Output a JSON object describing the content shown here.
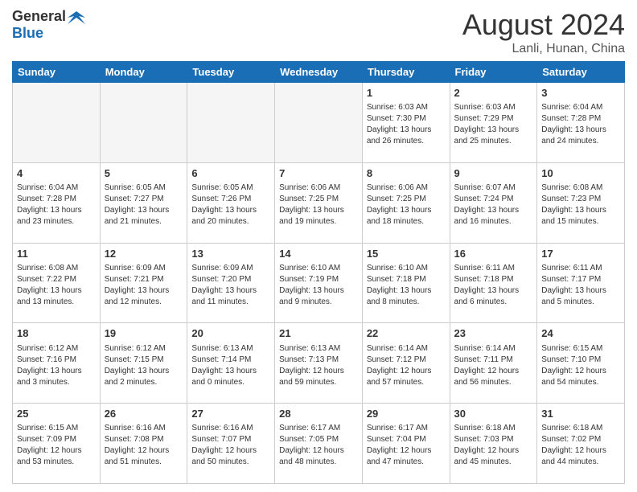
{
  "logo": {
    "general": "General",
    "blue": "Blue"
  },
  "title": "August 2024",
  "location": "Lanli, Hunan, China",
  "days_header": [
    "Sunday",
    "Monday",
    "Tuesday",
    "Wednesday",
    "Thursday",
    "Friday",
    "Saturday"
  ],
  "weeks": [
    [
      {
        "day": "",
        "info": ""
      },
      {
        "day": "",
        "info": ""
      },
      {
        "day": "",
        "info": ""
      },
      {
        "day": "",
        "info": ""
      },
      {
        "day": "1",
        "info": "Sunrise: 6:03 AM\nSunset: 7:30 PM\nDaylight: 13 hours\nand 26 minutes."
      },
      {
        "day": "2",
        "info": "Sunrise: 6:03 AM\nSunset: 7:29 PM\nDaylight: 13 hours\nand 25 minutes."
      },
      {
        "day": "3",
        "info": "Sunrise: 6:04 AM\nSunset: 7:28 PM\nDaylight: 13 hours\nand 24 minutes."
      }
    ],
    [
      {
        "day": "4",
        "info": "Sunrise: 6:04 AM\nSunset: 7:28 PM\nDaylight: 13 hours\nand 23 minutes."
      },
      {
        "day": "5",
        "info": "Sunrise: 6:05 AM\nSunset: 7:27 PM\nDaylight: 13 hours\nand 21 minutes."
      },
      {
        "day": "6",
        "info": "Sunrise: 6:05 AM\nSunset: 7:26 PM\nDaylight: 13 hours\nand 20 minutes."
      },
      {
        "day": "7",
        "info": "Sunrise: 6:06 AM\nSunset: 7:25 PM\nDaylight: 13 hours\nand 19 minutes."
      },
      {
        "day": "8",
        "info": "Sunrise: 6:06 AM\nSunset: 7:25 PM\nDaylight: 13 hours\nand 18 minutes."
      },
      {
        "day": "9",
        "info": "Sunrise: 6:07 AM\nSunset: 7:24 PM\nDaylight: 13 hours\nand 16 minutes."
      },
      {
        "day": "10",
        "info": "Sunrise: 6:08 AM\nSunset: 7:23 PM\nDaylight: 13 hours\nand 15 minutes."
      }
    ],
    [
      {
        "day": "11",
        "info": "Sunrise: 6:08 AM\nSunset: 7:22 PM\nDaylight: 13 hours\nand 13 minutes."
      },
      {
        "day": "12",
        "info": "Sunrise: 6:09 AM\nSunset: 7:21 PM\nDaylight: 13 hours\nand 12 minutes."
      },
      {
        "day": "13",
        "info": "Sunrise: 6:09 AM\nSunset: 7:20 PM\nDaylight: 13 hours\nand 11 minutes."
      },
      {
        "day": "14",
        "info": "Sunrise: 6:10 AM\nSunset: 7:19 PM\nDaylight: 13 hours\nand 9 minutes."
      },
      {
        "day": "15",
        "info": "Sunrise: 6:10 AM\nSunset: 7:18 PM\nDaylight: 13 hours\nand 8 minutes."
      },
      {
        "day": "16",
        "info": "Sunrise: 6:11 AM\nSunset: 7:18 PM\nDaylight: 13 hours\nand 6 minutes."
      },
      {
        "day": "17",
        "info": "Sunrise: 6:11 AM\nSunset: 7:17 PM\nDaylight: 13 hours\nand 5 minutes."
      }
    ],
    [
      {
        "day": "18",
        "info": "Sunrise: 6:12 AM\nSunset: 7:16 PM\nDaylight: 13 hours\nand 3 minutes."
      },
      {
        "day": "19",
        "info": "Sunrise: 6:12 AM\nSunset: 7:15 PM\nDaylight: 13 hours\nand 2 minutes."
      },
      {
        "day": "20",
        "info": "Sunrise: 6:13 AM\nSunset: 7:14 PM\nDaylight: 13 hours\nand 0 minutes."
      },
      {
        "day": "21",
        "info": "Sunrise: 6:13 AM\nSunset: 7:13 PM\nDaylight: 12 hours\nand 59 minutes."
      },
      {
        "day": "22",
        "info": "Sunrise: 6:14 AM\nSunset: 7:12 PM\nDaylight: 12 hours\nand 57 minutes."
      },
      {
        "day": "23",
        "info": "Sunrise: 6:14 AM\nSunset: 7:11 PM\nDaylight: 12 hours\nand 56 minutes."
      },
      {
        "day": "24",
        "info": "Sunrise: 6:15 AM\nSunset: 7:10 PM\nDaylight: 12 hours\nand 54 minutes."
      }
    ],
    [
      {
        "day": "25",
        "info": "Sunrise: 6:15 AM\nSunset: 7:09 PM\nDaylight: 12 hours\nand 53 minutes."
      },
      {
        "day": "26",
        "info": "Sunrise: 6:16 AM\nSunset: 7:08 PM\nDaylight: 12 hours\nand 51 minutes."
      },
      {
        "day": "27",
        "info": "Sunrise: 6:16 AM\nSunset: 7:07 PM\nDaylight: 12 hours\nand 50 minutes."
      },
      {
        "day": "28",
        "info": "Sunrise: 6:17 AM\nSunset: 7:05 PM\nDaylight: 12 hours\nand 48 minutes."
      },
      {
        "day": "29",
        "info": "Sunrise: 6:17 AM\nSunset: 7:04 PM\nDaylight: 12 hours\nand 47 minutes."
      },
      {
        "day": "30",
        "info": "Sunrise: 6:18 AM\nSunset: 7:03 PM\nDaylight: 12 hours\nand 45 minutes."
      },
      {
        "day": "31",
        "info": "Sunrise: 6:18 AM\nSunset: 7:02 PM\nDaylight: 12 hours\nand 44 minutes."
      }
    ]
  ]
}
